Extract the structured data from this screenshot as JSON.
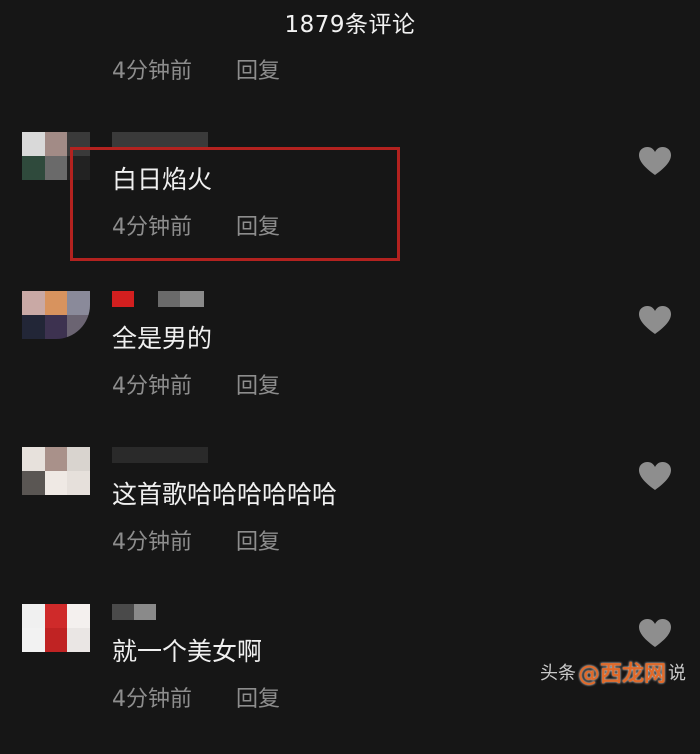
{
  "header": {
    "title": "1879条评论"
  },
  "top_meta": {
    "time": "4分钟前",
    "reply": "回复"
  },
  "comments": [
    {
      "text": "白日焰火",
      "time": "4分钟前",
      "reply": "回复"
    },
    {
      "text": "全是男的",
      "time": "4分钟前",
      "reply": "回复"
    },
    {
      "text": "这首歌哈哈哈哈哈哈",
      "time": "4分钟前",
      "reply": "回复"
    },
    {
      "text": "就一个美女啊",
      "time": "4分钟前",
      "reply": "回复"
    }
  ],
  "watermark": {
    "prefix": "头条",
    "brand": "@西龙网",
    "suffix": "说"
  },
  "colors": {
    "background": "#161616",
    "highlight_box": "#b3221f",
    "meta_text": "#8d8d8d",
    "like_icon": "#8e8e8e"
  },
  "icons": {
    "like": "heart-icon"
  }
}
